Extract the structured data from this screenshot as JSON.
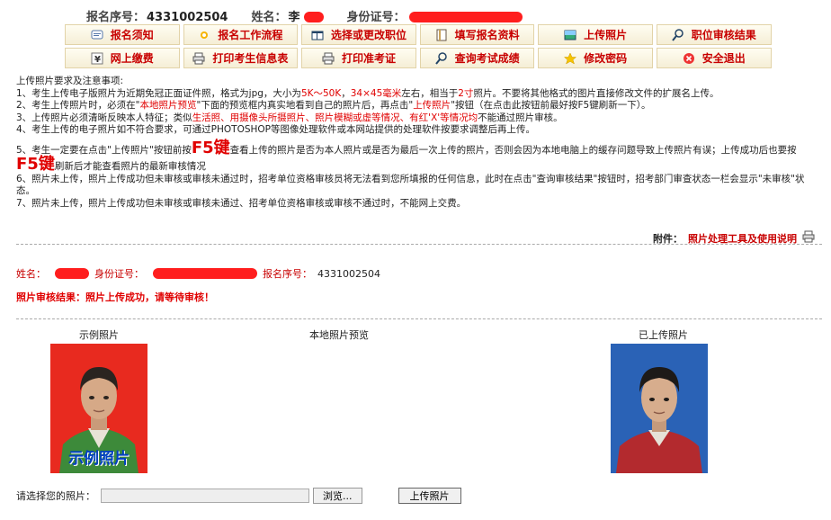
{
  "header": {
    "reg_label": "报名序号：",
    "reg_value": "4331002504",
    "name_label": "姓名：",
    "name_value": "李",
    "id_label": "身份证号："
  },
  "menu": [
    {
      "label": "报名须知",
      "icon": "notice-icon"
    },
    {
      "label": "报名工作流程",
      "icon": "flow-icon"
    },
    {
      "label": "选择或更改职位",
      "icon": "position-icon"
    },
    {
      "label": "填写报名资料",
      "icon": "form-icon"
    },
    {
      "label": "上传照片",
      "icon": "photo-icon"
    },
    {
      "label": "职位审核结果",
      "icon": "search-icon"
    },
    {
      "label": "网上缴费",
      "icon": "yen-icon"
    },
    {
      "label": "打印考生信息表",
      "icon": "printer-icon"
    },
    {
      "label": "打印准考证",
      "icon": "printer-icon"
    },
    {
      "label": "查询考试成绩",
      "icon": "search-icon"
    },
    {
      "label": "修改密码",
      "icon": "star-icon"
    },
    {
      "label": "安全退出",
      "icon": "exit-icon"
    }
  ],
  "requirements": {
    "title": "上传照片要求及注意事项:",
    "item1_a": "1、考生上传电子版照片为近期免冠正面证件照，格式为jpg，大小为",
    "item1_size": "5K～50K",
    "item1_b": "，",
    "item1_dim": "34×45毫米",
    "item1_c": "左右，相当于",
    "item1_inch": "2寸",
    "item1_d": "照片。不要将其他格式的图片直接修改文件的扩展名上传。",
    "item2_a": "2、考生上传照片时，必须在\"",
    "item2_preview": "本地照片预览",
    "item2_b": "\"下面的预览框内真实地看到自己的照片后，再点击\"",
    "item2_upload": "上传照片",
    "item2_c": "\"按钮（在点击此按钮前最好按F5键刷新一下）。",
    "item3_a": "3、上传照片必须清晰反映本人特征；类似",
    "item3_red": "生活照、用摄像头所摄照片、照片模糊或虚等情况、有红'X'等情况均",
    "item3_b": "不能通过照片审核。",
    "item4": "4、考生上传的电子照片如不符合要求，可通过PHOTOSHOP等图像处理软件或本网站提供的处理软件按要求调整后再上传。",
    "item5_a": "5、考生一定要在点击\"上传照片\"按钮前按",
    "item5_key": "F5键",
    "item5_b": "查看上传的照片是否为本人照片或是否为最后一次上传的照片，否则会因为本地电脑上的缓存问题导致上传照片有误；上传成功后也要按",
    "item5_key2": "F5键",
    "item5_c": "刷新后才能查看照片的最新审核情况",
    "item6": "6、照片未上传，照片上传成功但未审核或审核未通过时，招考单位资格审核员将无法看到您所填报的任何信息，此时在点击\"查询审核结果\"按钮时，招考部门审查状态一栏会显示\"未审核\"状态。",
    "item7": "7、照片未上传，照片上传成功但未审核或审核未通过、招考单位资格审核或审核不通过时，不能网上交费。"
  },
  "attachment": {
    "label": "附件：",
    "link": "照片处理工具及使用说明"
  },
  "applicant": {
    "name_label": "姓名：",
    "id_label": "身份证号：",
    "reg_label": "报名序号：",
    "reg_value": "4331002504"
  },
  "review_result": "照片审核结果：照片上传成功，请等待审核！",
  "photos": {
    "sample_title": "示例照片",
    "sample_caption": "示例照片",
    "preview_title": "本地照片预览",
    "uploaded_title": "已上传照片"
  },
  "upload": {
    "label": "请选择您的照片：",
    "browse": "浏览...",
    "submit": "上传照片"
  }
}
